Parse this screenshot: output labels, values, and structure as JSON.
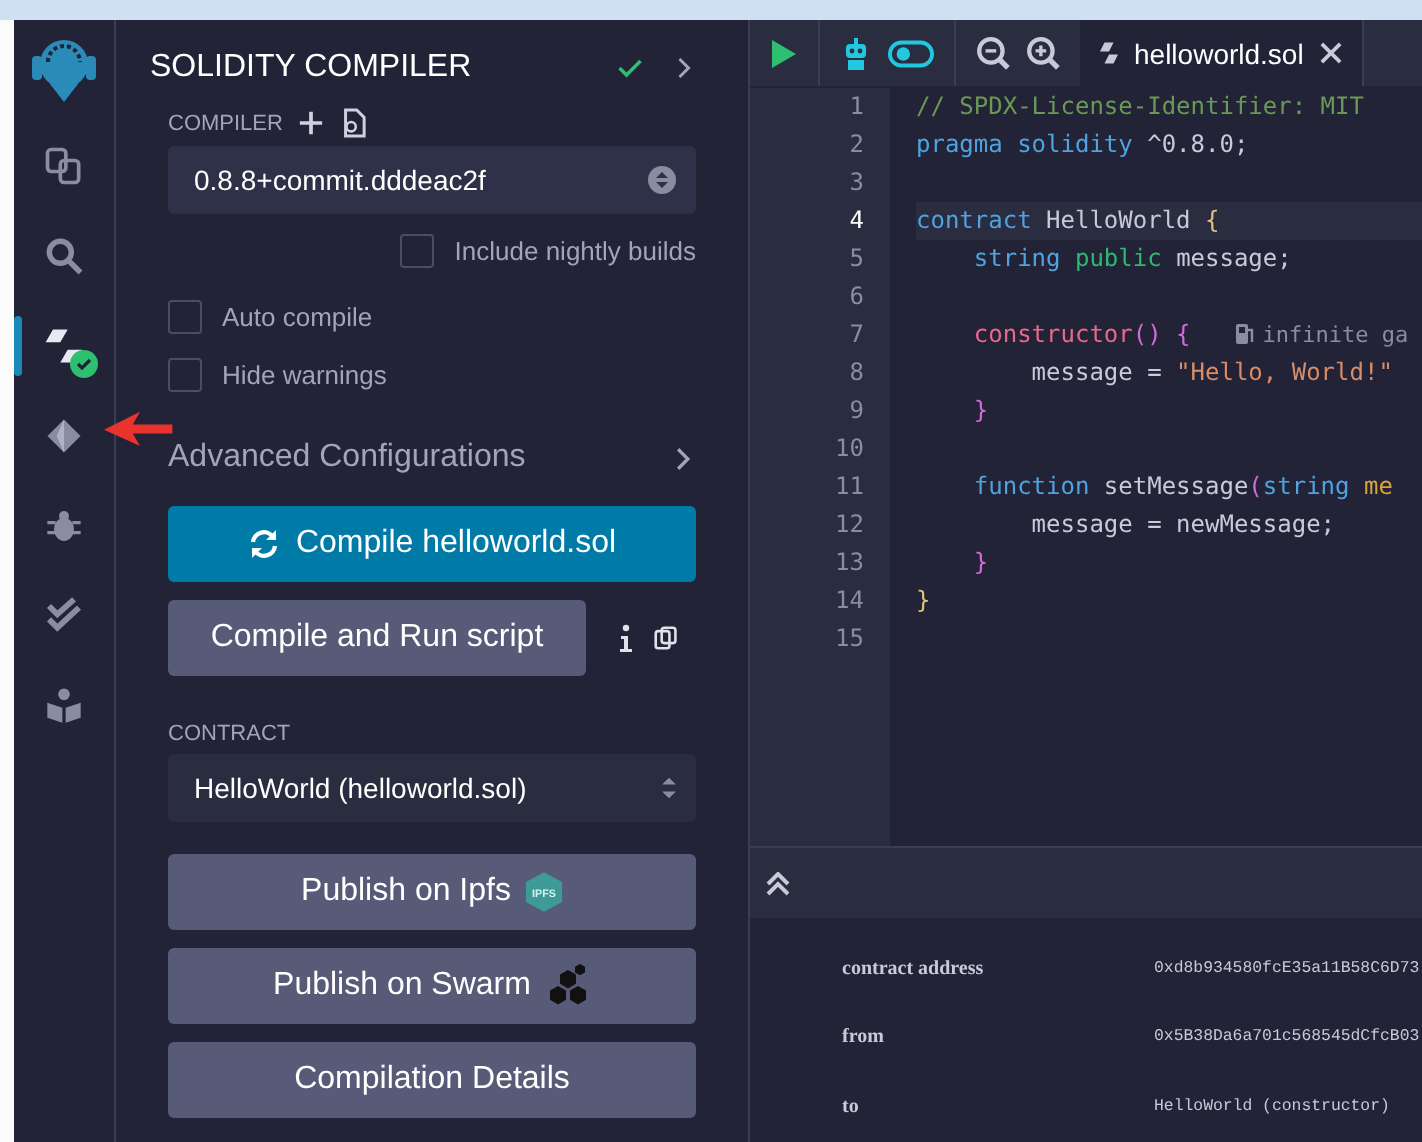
{
  "icon_bar": [
    {
      "kind": "files",
      "selected": false
    },
    {
      "kind": "search",
      "selected": false
    },
    {
      "kind": "compiler",
      "selected": true
    },
    {
      "kind": "deploy",
      "selected": false
    },
    {
      "kind": "debugger",
      "selected": false
    },
    {
      "kind": "tests",
      "selected": false
    },
    {
      "kind": "learn",
      "selected": false
    }
  ],
  "panel": {
    "title": "SOLIDITY COMPILER",
    "compiler_label": "COMPILER",
    "compiler_version": "0.8.8+commit.dddeac2f",
    "nightly": {
      "label": "Include nightly builds",
      "checked": false
    },
    "options": [
      {
        "label": "Auto compile",
        "checked": false
      },
      {
        "label": "Hide warnings",
        "checked": false
      }
    ],
    "advanced": "Advanced Configurations",
    "compile_button": "Compile helloworld.sol",
    "run_button": "Compile and Run script",
    "contract_label": "CONTRACT",
    "contract": "HelloWorld (helloworld.sol)",
    "buttons": [
      {
        "label": "Publish on Ipfs",
        "kind": "ipfs",
        "badge": "IPFS"
      },
      {
        "label": "Publish on Swarm",
        "kind": "swarm"
      },
      {
        "label": "Compilation Details",
        "kind": "plain"
      }
    ]
  },
  "editor": {
    "tab": "helloworld.sol",
    "lines": [
      {
        "number": "1",
        "current": false,
        "tokens": [
          {
            "text": "// SPDX-License-Identifier: MIT",
            "kind": "comment"
          }
        ]
      },
      {
        "number": "2",
        "current": false,
        "tokens": [
          {
            "text": "pragma solidity ",
            "kind": "keyword"
          },
          {
            "text": "^0.8.0;",
            "kind": "plain"
          }
        ]
      },
      {
        "number": "3",
        "current": false
      },
      {
        "number": "4",
        "current": true,
        "tokens": [
          {
            "text": "contract ",
            "kind": "keyword"
          },
          {
            "text": "HelloWorld ",
            "kind": "plain"
          },
          {
            "text": "{",
            "kind": "brace1"
          }
        ]
      },
      {
        "number": "5",
        "current": false,
        "tokens": [
          {
            "text": "    string ",
            "kind": "keyword"
          },
          {
            "text": "public ",
            "kind": "modifier"
          },
          {
            "text": "message;",
            "kind": "plain"
          }
        ]
      },
      {
        "number": "6",
        "current": false
      },
      {
        "number": "7",
        "current": false,
        "tokens": [
          {
            "text": "    constructor",
            "kind": "ctor"
          },
          {
            "text": "() {",
            "kind": "brace2"
          },
          {
            "text": "infinite ga",
            "kind": "hint"
          }
        ]
      },
      {
        "number": "8",
        "current": false,
        "tokens": [
          {
            "text": "        message = ",
            "kind": "plain"
          },
          {
            "text": "\"Hello, World!\"",
            "kind": "string"
          }
        ]
      },
      {
        "number": "9",
        "current": false,
        "tokens": [
          {
            "text": "    }",
            "kind": "brace2"
          }
        ]
      },
      {
        "number": "10",
        "current": false
      },
      {
        "number": "11",
        "current": false,
        "tokens": [
          {
            "text": "    function ",
            "kind": "keyword"
          },
          {
            "text": "setMessage",
            "kind": "plain"
          },
          {
            "text": "(",
            "kind": "brace2"
          },
          {
            "text": "string ",
            "kind": "keyword"
          },
          {
            "text": "me",
            "kind": "param"
          }
        ]
      },
      {
        "number": "12",
        "current": false,
        "tokens": [
          {
            "text": "        message = newMessage;",
            "kind": "plain"
          }
        ]
      },
      {
        "number": "13",
        "current": false,
        "tokens": [
          {
            "text": "    }",
            "kind": "brace2"
          }
        ]
      },
      {
        "number": "14",
        "current": false,
        "tokens": [
          {
            "text": "}",
            "kind": "brace1"
          }
        ]
      },
      {
        "number": "15",
        "current": false
      }
    ]
  },
  "terminal": {
    "rows": [
      {
        "label": "contract address",
        "value": "0xd8b934580fcE35a11B58C6D73"
      },
      {
        "label": "from",
        "value": "0x5B38Da6a701c568545dCfcB03"
      },
      {
        "label": "to",
        "value": "HelloWorld (constructor)"
      }
    ]
  }
}
